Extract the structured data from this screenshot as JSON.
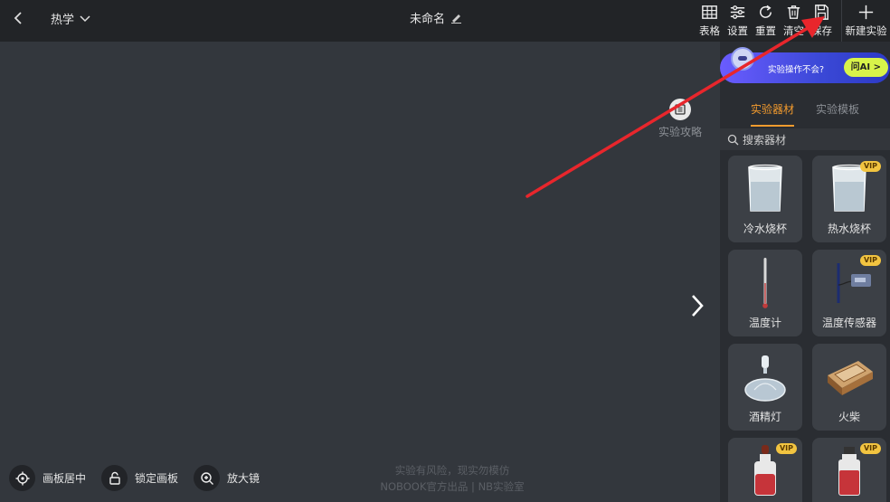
{
  "topbar": {
    "subject": "热学",
    "title": "未命名",
    "tools": [
      {
        "label": "表格",
        "icon": "table-icon"
      },
      {
        "label": "设置",
        "icon": "sliders-icon"
      },
      {
        "label": "重置",
        "icon": "reset-icon"
      },
      {
        "label": "清空",
        "icon": "trash-icon"
      },
      {
        "label": "保存",
        "icon": "save-icon"
      }
    ],
    "new_label": "新建实验"
  },
  "canvas": {
    "guide_label": "实验攻略",
    "watermark_line1": "实验有风险，现实勿模仿",
    "watermark_line2": "NOBOOK官方出品 | NB实验室",
    "buttons": [
      {
        "label": "画板居中",
        "icon": "target-icon"
      },
      {
        "label": "锁定画板",
        "icon": "lock-icon"
      },
      {
        "label": "放大镜",
        "icon": "zoom-in-icon"
      }
    ]
  },
  "panel": {
    "ai_text": "实验操作不会?",
    "ai_button": "问AI >",
    "tabs": [
      {
        "label": "实验器材",
        "active": true
      },
      {
        "label": "实验模板",
        "active": false
      }
    ],
    "search_placeholder": "搜索器材",
    "items": [
      {
        "name": "冷水烧杯",
        "vip": false
      },
      {
        "name": "热水烧杯",
        "vip": true
      },
      {
        "name": "温度计",
        "vip": false
      },
      {
        "name": "温度传感器",
        "vip": true
      },
      {
        "name": "酒精灯",
        "vip": false
      },
      {
        "name": "火柴",
        "vip": false
      },
      {
        "name": "",
        "vip": true
      },
      {
        "name": "",
        "vip": true
      }
    ],
    "vip_label": "VIP"
  },
  "colors": {
    "accent": "#f39b2e",
    "arrow": "#e8262c",
    "topbar": "#222427",
    "canvas": "#33373d"
  }
}
